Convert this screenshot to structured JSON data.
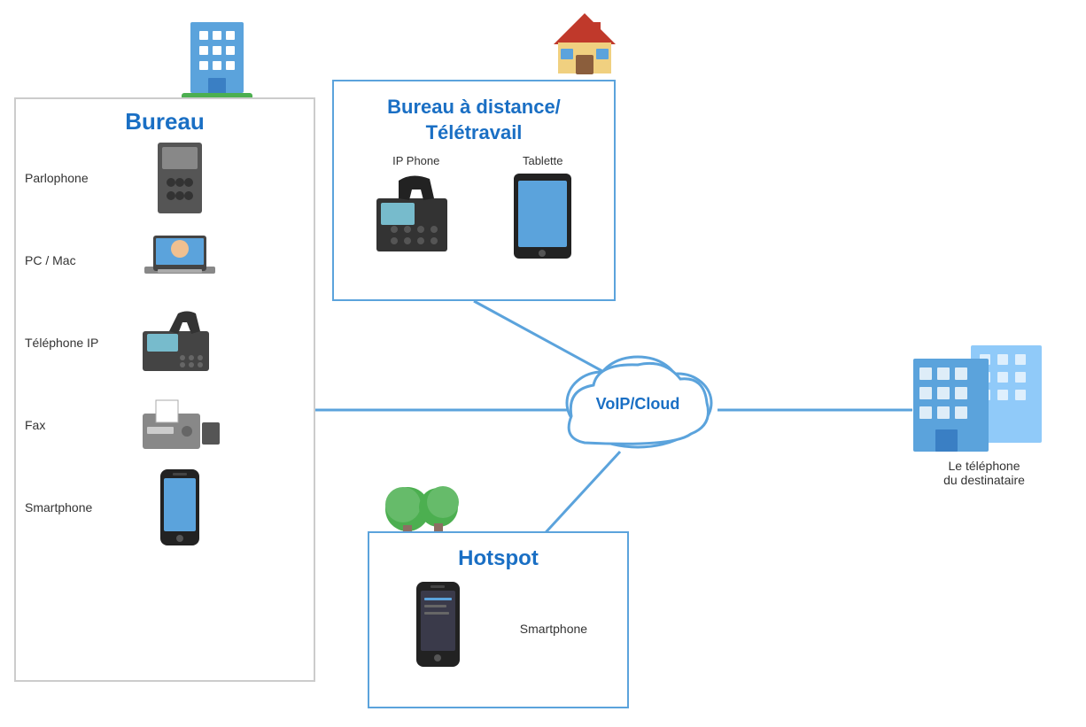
{
  "bureau": {
    "title": "Bureau",
    "items": [
      {
        "label": "Parlophone",
        "icon": "parlophone"
      },
      {
        "label": "PC / Mac",
        "icon": "pc-mac"
      },
      {
        "label": "Téléphone IP",
        "icon": "ip-phone-bureau"
      },
      {
        "label": "Fax",
        "icon": "fax"
      },
      {
        "label": "Smartphone",
        "icon": "smartphone-bureau"
      }
    ]
  },
  "remote": {
    "title": "Bureau à distance/\nTélétravail",
    "devices": [
      {
        "label": "IP Phone",
        "icon": "ip-phone"
      },
      {
        "label": "Tablette",
        "icon": "tablet"
      }
    ]
  },
  "hotspot": {
    "title": "Hotspot",
    "device_label": "Smartphone"
  },
  "voip": {
    "label": "VoIP/Cloud"
  },
  "destination": {
    "label": "Le téléphone\ndu destinataire"
  },
  "colors": {
    "blue": "#1a6fc4",
    "light_blue": "#5ba3dc",
    "line_color": "#5ba3dc"
  }
}
